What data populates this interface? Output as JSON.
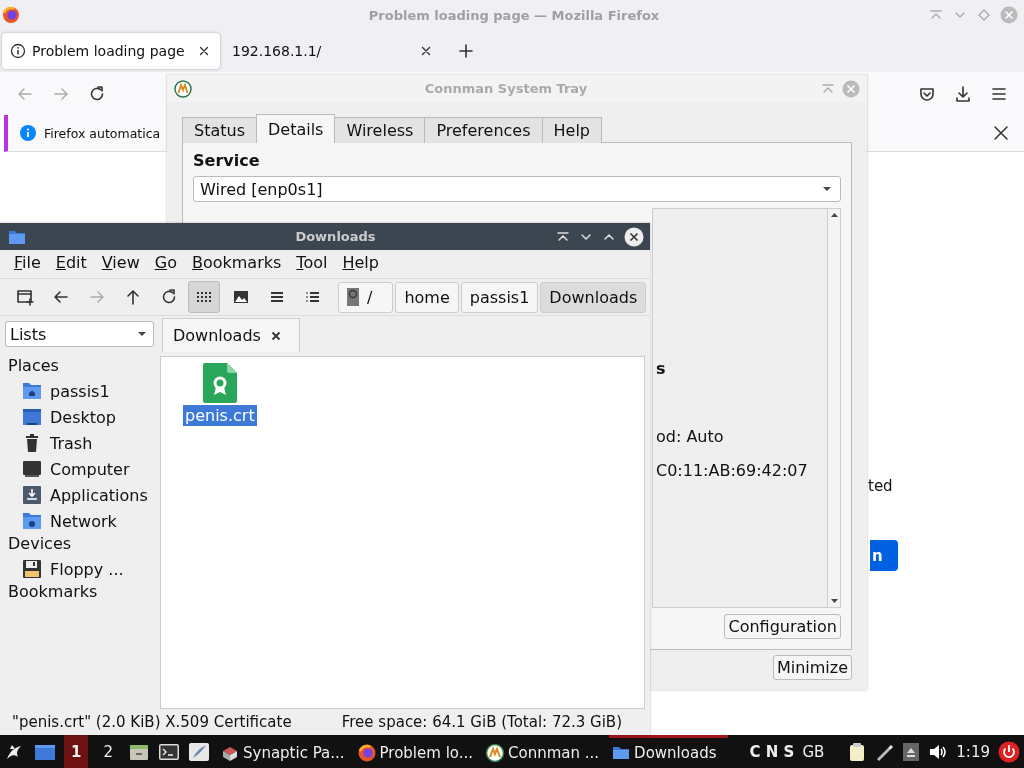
{
  "firefox": {
    "title": "Problem loading page — Mozilla Firefox",
    "tabs": [
      {
        "label": "Problem loading page",
        "selected": true
      },
      {
        "label": "192.168.1.1/",
        "selected": false
      }
    ],
    "notification": "Firefox automatica",
    "page_text": "ted",
    "page_button": "n"
  },
  "connman": {
    "title": "Connman System Tray",
    "tabs": [
      {
        "label": "Status",
        "selected": false
      },
      {
        "label": "Details",
        "selected": true
      },
      {
        "label": "Wireless",
        "selected": false
      },
      {
        "label": "Preferences",
        "selected": false
      },
      {
        "label": "Help",
        "selected": false
      }
    ],
    "service_label": "Service",
    "service_value": "Wired [enp0s1]",
    "details": [
      {
        "kind": "heading",
        "text": "s"
      },
      {
        "kind": "line",
        "text": "od: Auto"
      },
      {
        "kind": "line",
        "text": "C0:11:AB:69:42:07"
      }
    ],
    "configuration_button": "Configuration",
    "minimize_button": "Minimize"
  },
  "file_manager": {
    "title": "Downloads",
    "menu": [
      "File",
      "Edit",
      "View",
      "Go",
      "Bookmarks",
      "Tool",
      "Help"
    ],
    "view_modes": [
      {
        "kind": "icons",
        "selected": true
      },
      {
        "kind": "thumbnails",
        "selected": false
      },
      {
        "kind": "compact",
        "selected": false
      },
      {
        "kind": "detailed",
        "selected": false
      }
    ],
    "path": [
      {
        "label": "/",
        "kind": "root",
        "selected": false
      },
      {
        "label": "home",
        "selected": false
      },
      {
        "label": "passis1",
        "selected": false
      },
      {
        "label": "Downloads",
        "selected": true
      }
    ],
    "side_pane_mode": "Lists",
    "tab": "Downloads",
    "sidebar": [
      {
        "label": "Places",
        "children": [
          {
            "label": "passis1",
            "kind": "home"
          },
          {
            "label": "Desktop",
            "kind": "desktop"
          },
          {
            "label": "Trash",
            "kind": "trash"
          },
          {
            "label": "Computer",
            "kind": "computer"
          },
          {
            "label": "Applications",
            "kind": "applications"
          },
          {
            "label": "Network",
            "kind": "network"
          }
        ]
      },
      {
        "label": "Devices",
        "children": [
          {
            "label": "Floppy ...",
            "kind": "floppy"
          }
        ]
      },
      {
        "label": "Bookmarks"
      }
    ],
    "files": [
      {
        "name": "penis.crt",
        "selected": true
      }
    ],
    "status_bar": {
      "selection": "\"penis.crt\" (2.0 KiB) X.509 Certificate",
      "free_space": "Free space: 64.1 GiB (Total: 72.3 GiB)"
    }
  },
  "taskbar": {
    "workspaces": [
      {
        "label": "1",
        "selected": true
      },
      {
        "label": "2",
        "selected": false
      }
    ],
    "tasks": [
      {
        "label": "Synaptic Pa...",
        "kind": "package",
        "selected": false
      },
      {
        "label": "Problem lo...",
        "kind": "browser",
        "selected": false
      },
      {
        "label": "Connman ...",
        "kind": "network",
        "selected": false
      },
      {
        "label": "Downloads",
        "kind": "folder",
        "selected": true
      }
    ],
    "indicators": "C N S",
    "keyboard": "GB",
    "clock": "1:19"
  }
}
